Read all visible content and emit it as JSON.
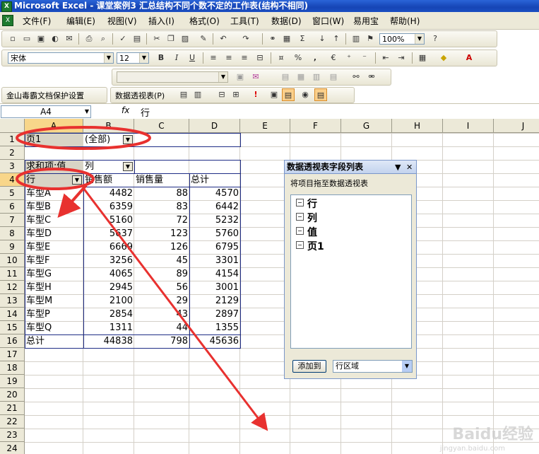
{
  "window": {
    "title": "Microsoft Excel - 课堂案例3  汇总结构不同个数不定的工作表(结构不相同)"
  },
  "menu": [
    "文件(F)",
    "编辑(E)",
    "视图(V)",
    "插入(I)",
    "格式(O)",
    "工具(T)",
    "数据(D)",
    "窗口(W)",
    "易用宝",
    "帮助(H)"
  ],
  "toolbar": {
    "zoom": "100%",
    "font_name": "宋体",
    "font_size": "12",
    "bold": "B",
    "italic": "I",
    "underline": "U",
    "percent": "%",
    "comma": ",",
    "euro": "€",
    "sigma": "Σ",
    "protect_label": "金山毒霸文档保护设置",
    "pivot_label": "数据透视表(P)"
  },
  "formula_bar": {
    "name_box": "A4",
    "fx": "fx",
    "content": "行"
  },
  "columns": [
    "A",
    "B",
    "C",
    "D",
    "E",
    "F",
    "G",
    "H",
    "I",
    "J"
  ],
  "rows": [
    "1",
    "2",
    "3",
    "4",
    "5",
    "6",
    "7",
    "8",
    "9",
    "10",
    "11",
    "12",
    "13",
    "14",
    "15",
    "16",
    "17",
    "18",
    "19",
    "20",
    "21",
    "22",
    "23",
    "24"
  ],
  "pivot": {
    "page_label": "页1",
    "page_value": "(全部)",
    "data_label": "求和项:值",
    "col_field": "列",
    "row_field": "行",
    "col_headers": [
      "销售额",
      "销售量",
      "总计"
    ],
    "rows": [
      {
        "name": "车型A",
        "v1": "4482",
        "v2": "88",
        "total": "4570"
      },
      {
        "name": "车型B",
        "v1": "6359",
        "v2": "83",
        "total": "6442"
      },
      {
        "name": "车型C",
        "v1": "5160",
        "v2": "72",
        "total": "5232"
      },
      {
        "name": "车型D",
        "v1": "5637",
        "v2": "123",
        "total": "5760"
      },
      {
        "name": "车型E",
        "v1": "6669",
        "v2": "126",
        "total": "6795"
      },
      {
        "name": "车型F",
        "v1": "3256",
        "v2": "45",
        "total": "3301"
      },
      {
        "name": "车型G",
        "v1": "4065",
        "v2": "89",
        "total": "4154"
      },
      {
        "name": "车型H",
        "v1": "2945",
        "v2": "56",
        "total": "3001"
      },
      {
        "name": "车型M",
        "v1": "2100",
        "v2": "29",
        "total": "2129"
      },
      {
        "name": "车型P",
        "v1": "2854",
        "v2": "43",
        "total": "2897"
      },
      {
        "name": "车型Q",
        "v1": "1311",
        "v2": "44",
        "total": "1355"
      }
    ],
    "grand_total": {
      "name": "总计",
      "v1": "44838",
      "v2": "798",
      "total": "45636"
    }
  },
  "field_panel": {
    "title": "数据透视表字段列表",
    "hint": "将项目拖至数据透视表",
    "fields": [
      "行",
      "列",
      "值",
      "页1"
    ],
    "add_button": "添加到",
    "area": "行区域"
  },
  "watermark": {
    "logo": "Baidu经验",
    "url": "jingyan.baidu.com"
  },
  "annotation_color": "#e8312f"
}
